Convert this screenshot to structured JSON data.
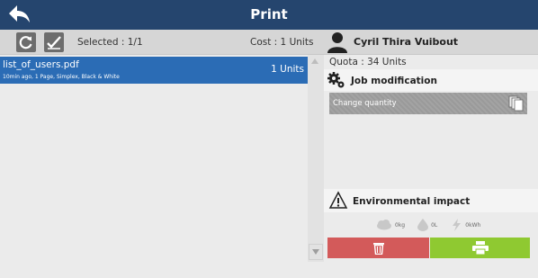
{
  "header": {
    "title": "Print"
  },
  "toolbar": {
    "selected": "Selected : 1/1",
    "cost": "Cost : 1 Units",
    "user_name": "Cyril Thira Vuibout"
  },
  "jobs": [
    {
      "name": "list_of_users.pdf",
      "details": "10min ago, 1 Page, Simplex, Black & White",
      "units": "1 Units"
    }
  ],
  "panel": {
    "quota": "Quota : 34 Units",
    "job_modification": "Job modification",
    "change_quantity": "Change quantity",
    "environmental_impact": "Environmental impact",
    "co2": "0kg",
    "water": "0L",
    "energy": "0kWh"
  },
  "colors": {
    "header_bg": "#25456e",
    "selected_row": "#2b6cb5",
    "delete": "#d35a5a",
    "print": "#8fc931"
  },
  "icons": [
    "back-arrow-icon",
    "refresh-icon",
    "check-all-icon",
    "user-icon",
    "gears-icon",
    "pages-icon",
    "environment-icon",
    "co2-icon",
    "water-drop-icon",
    "lightning-icon",
    "trash-icon",
    "printer-icon"
  ]
}
